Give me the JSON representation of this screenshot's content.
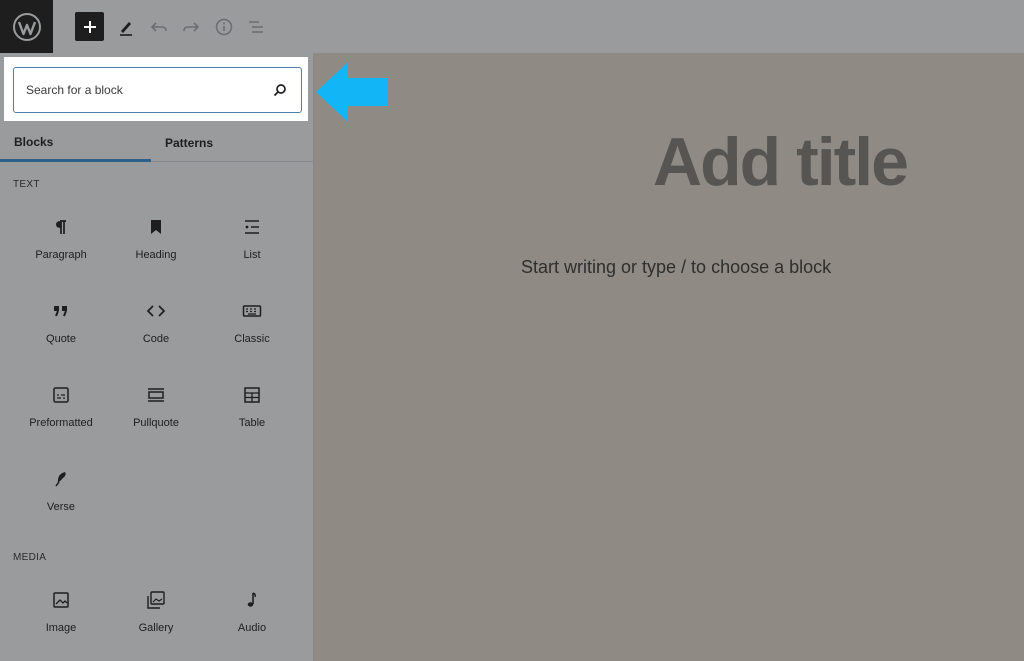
{
  "toolbar": {
    "logo_icon": "wordpress-logo-icon",
    "icons": [
      "plus-icon",
      "pencil-icon",
      "undo-icon",
      "redo-icon",
      "info-icon",
      "list-view-icon"
    ]
  },
  "search": {
    "placeholder": "Search for a block"
  },
  "tabs": {
    "blocks": "Blocks",
    "patterns": "Patterns"
  },
  "sections": {
    "text": {
      "label": "TEXT",
      "items": [
        {
          "label": "Paragraph",
          "icon": "paragraph-icon"
        },
        {
          "label": "Heading",
          "icon": "bookmark-icon"
        },
        {
          "label": "List",
          "icon": "list-icon"
        },
        {
          "label": "Quote",
          "icon": "quote-icon"
        },
        {
          "label": "Code",
          "icon": "code-icon"
        },
        {
          "label": "Classic",
          "icon": "keyboard-icon"
        },
        {
          "label": "Preformatted",
          "icon": "preformatted-icon"
        },
        {
          "label": "Pullquote",
          "icon": "pullquote-icon"
        },
        {
          "label": "Table",
          "icon": "table-icon"
        },
        {
          "label": "Verse",
          "icon": "feather-icon"
        }
      ]
    },
    "media": {
      "label": "MEDIA",
      "items": [
        {
          "label": "Image",
          "icon": "image-icon"
        },
        {
          "label": "Gallery",
          "icon": "gallery-icon"
        },
        {
          "label": "Audio",
          "icon": "music-note-icon"
        }
      ]
    }
  },
  "editor": {
    "title_placeholder": "Add title",
    "body_placeholder": "Start writing or type / to choose a block"
  },
  "colors": {
    "accent": "#2c5f8a",
    "arrow": "#12b5f5",
    "overlay": "#9a9b9d"
  }
}
